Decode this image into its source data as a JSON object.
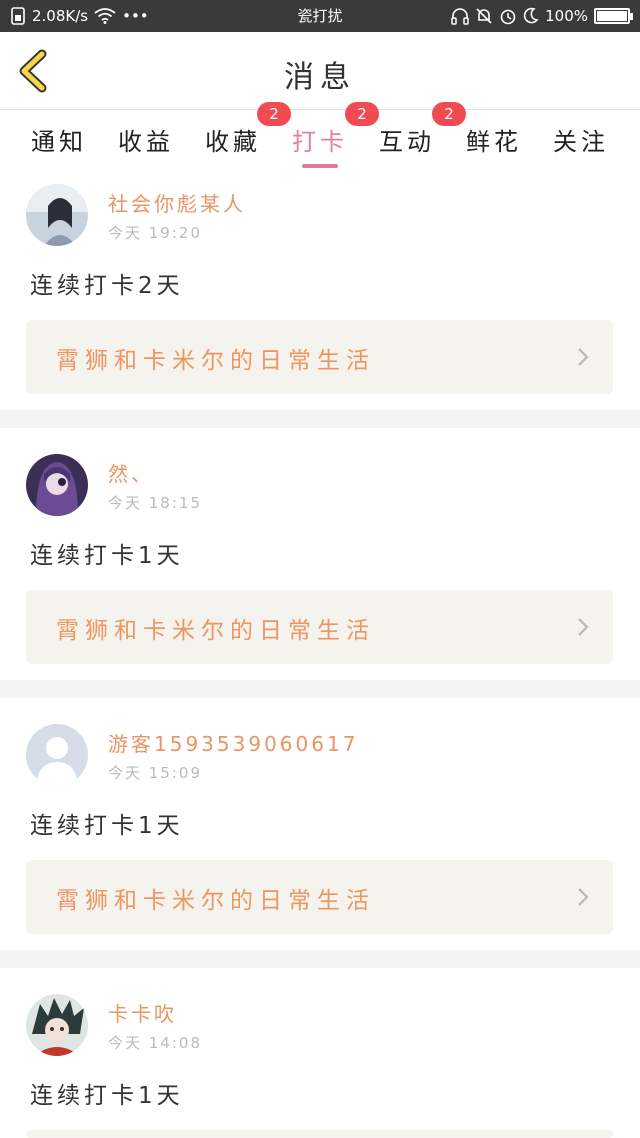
{
  "status_bar": {
    "speed": "2.08K/s",
    "more": "•••",
    "center_title": "瓷打扰",
    "battery": "100%"
  },
  "header": {
    "title": "消息"
  },
  "tabs": [
    {
      "label": "通知",
      "badge": ""
    },
    {
      "label": "收益",
      "badge": ""
    },
    {
      "label": "收藏",
      "badge": "2"
    },
    {
      "label": "打卡",
      "badge": "2"
    },
    {
      "label": "互动",
      "badge": "2"
    },
    {
      "label": "鲜花",
      "badge": ""
    },
    {
      "label": "关注",
      "badge": ""
    }
  ],
  "feed": [
    {
      "name": "社会你彪某人",
      "time": "今天  19:20",
      "text": "连续打卡2天",
      "topic": "霄狮和卡米尔的日常生活",
      "avatar": "avatar-girl-icon"
    },
    {
      "name": "然、",
      "time": "今天  18:15",
      "text": "连续打卡1天",
      "topic": "霄狮和卡米尔的日常生活",
      "avatar": "avatar-anime-purple-icon"
    },
    {
      "name": "游客1593539060617",
      "time": "今天  15:09",
      "text": "连续打卡1天",
      "topic": "霄狮和卡米尔的日常生活",
      "avatar": "avatar-default-user-icon"
    },
    {
      "name": "卡卡吹",
      "time": "今天  14:08",
      "text": "连续打卡1天",
      "topic": "",
      "avatar": "avatar-anime-boy-icon"
    }
  ],
  "colors": {
    "accent_pink": "#e5779a",
    "name_orange": "#e89563",
    "topic_orange": "#ee9660",
    "badge_red": "#f24a52",
    "back_yellow": "#f5d64b"
  }
}
